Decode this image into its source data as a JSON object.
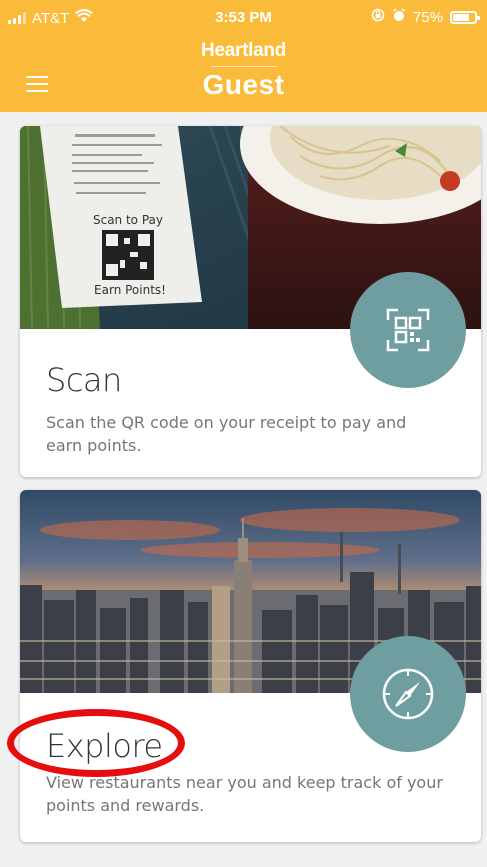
{
  "status_bar": {
    "carrier": "AT&T",
    "time": "3:53 PM",
    "battery": "75%",
    "wifi_icon": "wifi-icon",
    "signal_icon": "signal-icon",
    "lock_icon": "rotation-lock-icon",
    "alarm_icon": "alarm-icon",
    "battery_icon": "battery-icon"
  },
  "header": {
    "brand_line1": "Heartland",
    "brand_line2": "Guest",
    "menu_icon": "hamburger-menu-icon"
  },
  "cards": [
    {
      "title": "Scan",
      "description": "Scan the QR code on your receipt to pay and earn points.",
      "icon": "qr-code-icon",
      "image": "receipt-with-qr-code-and-pasta",
      "receipt_text": [
        "Scan to Pay",
        "Earn Points!"
      ]
    },
    {
      "title": "Explore",
      "description": "View restaurants near you and keep track of your points and rewards.",
      "icon": "compass-icon",
      "image": "city-skyline-at-sunset"
    }
  ],
  "colors": {
    "header": "#fbbb3a",
    "fab": "#6e9ea0",
    "annotation": "#e60d0d"
  }
}
